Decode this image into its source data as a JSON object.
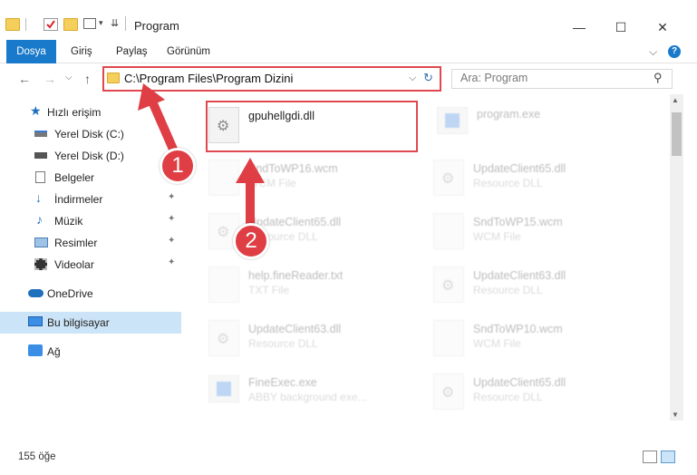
{
  "window": {
    "title": "Program",
    "controls": {
      "minimize": "—",
      "maximize": "☐",
      "close": "✕"
    }
  },
  "ribbon": {
    "tabs": [
      "Dosya",
      "Giriş",
      "Paylaş",
      "Görünüm"
    ],
    "expand_chevron": "⌵",
    "help": "?"
  },
  "navigation": {
    "back_arrow": "←",
    "forward_arrow": "→",
    "up_chevron": "⌵",
    "up_arrow": "↑",
    "address": "C:\\Program Files\\Program Dizini",
    "address_dropdown": "⌵",
    "refresh_glyph": "↻",
    "search_placeholder": "Ara: Program",
    "search_icon": "⚲"
  },
  "sidebar": {
    "items": [
      {
        "label": "Hızlı erişim",
        "icon": "star-icon"
      },
      {
        "label": "Yerel Disk (C:)",
        "icon": "drive-icon"
      },
      {
        "label": "Yerel Disk (D:)",
        "icon": "drive-icon"
      },
      {
        "label": "Belgeler",
        "icon": "documents-icon"
      },
      {
        "label": "İndirmeler",
        "icon": "download-icon",
        "pinned": true
      },
      {
        "label": "Müzik",
        "icon": "music-icon",
        "pinned": true
      },
      {
        "label": "Resimler",
        "icon": "pictures-icon",
        "pinned": true
      },
      {
        "label": "Videolar",
        "icon": "videos-icon",
        "pinned": true
      },
      {
        "label": "OneDrive",
        "icon": "cloud-icon"
      },
      {
        "label": "Bu bilgisayar",
        "icon": "computer-icon",
        "selected": true
      },
      {
        "label": "Ağ",
        "icon": "network-icon"
      }
    ],
    "pin_glyph": "📌"
  },
  "files": [
    {
      "name": "gpuhellgdi.dll",
      "type": "",
      "icon": "dll-gear-icon",
      "highlighted": true
    },
    {
      "name": "program.exe",
      "type": "",
      "icon": "exe-icon"
    },
    {
      "name": "SndToWP16.wcm",
      "type": "WCM File",
      "icon": "file-icon"
    },
    {
      "name": "UpdateClient65.dll",
      "type": "Resource DLL",
      "icon": "dll-gear-icon"
    },
    {
      "name": "UpdateClient65.dll",
      "type": "Resource DLL",
      "icon": "dll-gear-icon"
    },
    {
      "name": "SndToWP15.wcm",
      "type": "WCM File",
      "icon": "file-icon"
    },
    {
      "name": "help.fineReader.txt",
      "type": "TXT File",
      "icon": "file-icon"
    },
    {
      "name": "UpdateClient63.dll",
      "type": "Resource DLL",
      "icon": "dll-gear-icon"
    },
    {
      "name": "UpdateClient63.dll",
      "type": "Resource DLL",
      "icon": "dll-gear-icon"
    },
    {
      "name": "SndToWP10.wcm",
      "type": "WCM File",
      "icon": "file-icon"
    },
    {
      "name": "FineExec.exe",
      "type": "ABBY background exe...",
      "icon": "exe-icon"
    },
    {
      "name": "UpdateClient65.dll",
      "type": "Resource DLL",
      "icon": "dll-gear-icon"
    }
  ],
  "scrollbar": {
    "up": "▲",
    "down": "▼"
  },
  "status": {
    "count": "155 öğe"
  },
  "annotations": {
    "step1": "1",
    "step2": "2",
    "accent": "#df3e44"
  }
}
